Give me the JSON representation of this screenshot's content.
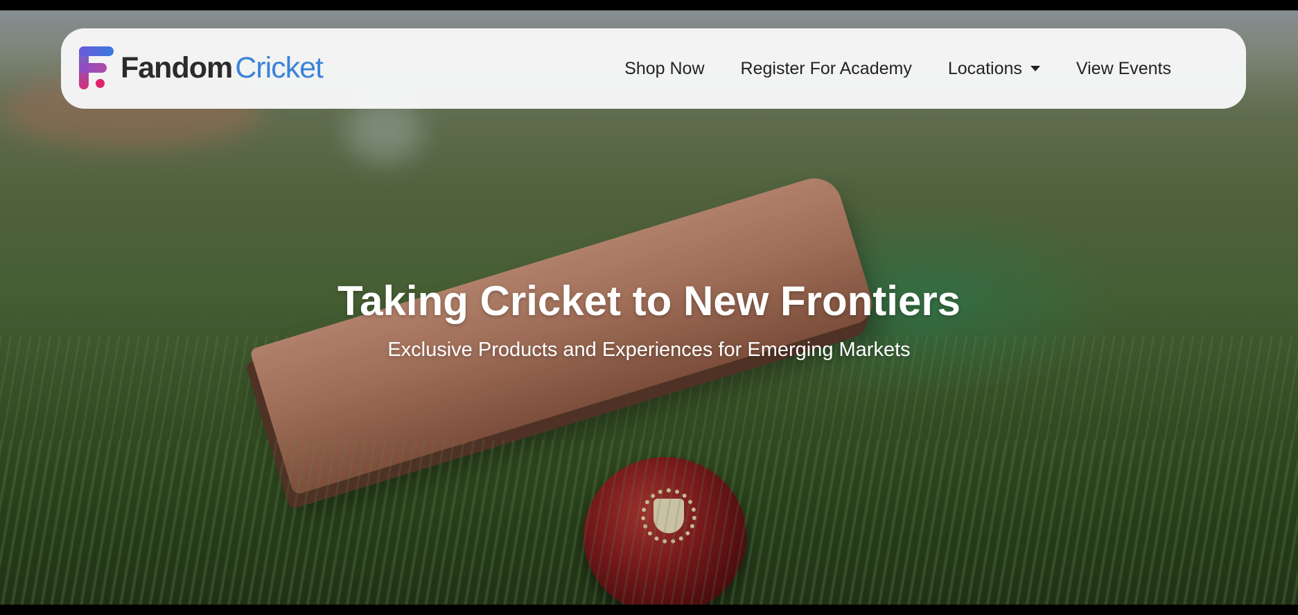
{
  "brand": {
    "word1": "Fandom",
    "word2": "Cricket"
  },
  "nav": {
    "items": [
      {
        "label": "Shop Now"
      },
      {
        "label": "Register For Academy"
      },
      {
        "label": "Locations",
        "has_dropdown": true
      },
      {
        "label": "View Events"
      }
    ]
  },
  "hero": {
    "title": "Taking Cricket to New Frontiers",
    "subtitle": "Exclusive Products and Experiences for Emerging Markets"
  },
  "colors": {
    "brand_dark": "#2b2b2b",
    "brand_blue": "#3a83d8",
    "logo_pink": "#e0246e",
    "navbar_bg": "#f8f8f9"
  },
  "icons": {
    "dropdown": "caret-down-icon"
  }
}
